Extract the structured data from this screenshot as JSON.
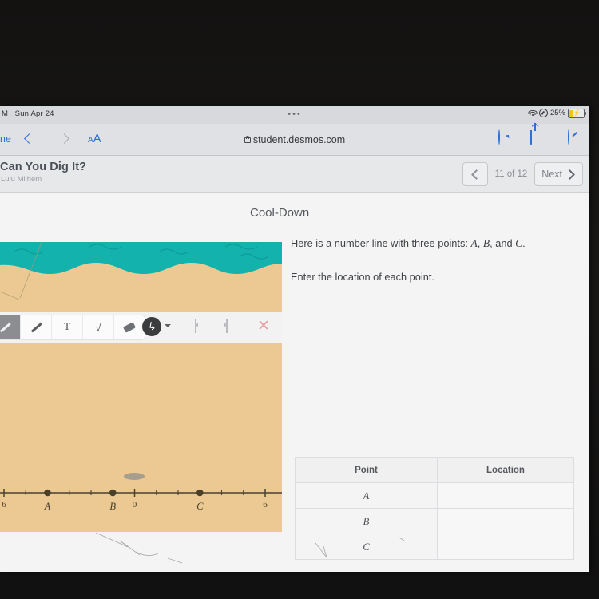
{
  "status_bar": {
    "time_cut": "M",
    "date": "Sun Apr 24",
    "dots": "•••",
    "battery_pct": "25%",
    "wifi_icon": "wifi-icon",
    "location_icon": "location-icon",
    "battery_icon": "battery-charging-icon"
  },
  "browser": {
    "done_label": "ne",
    "back_icon": "chevron-left-icon",
    "forward_icon": "chevron-right-icon",
    "text_size_label": "A",
    "text_size_small": "A",
    "url": "student.desmos.com",
    "lock_icon": "lock-icon",
    "reload_icon": "reload-icon",
    "share_icon": "share-icon",
    "tabs_icon": "compass-icon"
  },
  "activity": {
    "title": "Can You Dig It?",
    "author": "Lulu Milhem",
    "prev_icon": "chevron-left-icon",
    "pager": "11 of 12",
    "next_label": "Next",
    "next_icon": "chevron-right-icon"
  },
  "main": {
    "section_title": "Cool-Down",
    "prompt_prefix": "Here is a number line with three points: ",
    "point_a": "A",
    "comma1": ", ",
    "point_b": "B",
    "comma2": ", and ",
    "point_c": "C",
    "period": ".",
    "instruction": "Enter the location of each point."
  },
  "table": {
    "headers": [
      "Point",
      "Location"
    ],
    "rows": [
      {
        "point": "A",
        "location": ""
      },
      {
        "point": "B",
        "location": ""
      },
      {
        "point": "C",
        "location": ""
      }
    ]
  },
  "toolbar": {
    "tools": [
      {
        "name": "pen-tool",
        "icon": "pen-icon",
        "selected": true
      },
      {
        "name": "pencil-tool",
        "icon": "pencil-icon",
        "selected": false
      },
      {
        "name": "text-tool",
        "icon": "text-T-icon",
        "label": "T",
        "selected": false
      },
      {
        "name": "math-tool",
        "icon": "square-root-icon",
        "label": "√",
        "selected": false
      },
      {
        "name": "eraser-tool",
        "icon": "eraser-icon",
        "selected": false
      }
    ],
    "lasso_icon": "lasso-icon",
    "dropdown_icon": "chevron-down-icon",
    "undo_icon": "undo-icon",
    "redo_icon": "redo-icon",
    "close_icon": "close-x-icon"
  },
  "colors": {
    "water": "#13b2ac",
    "sand": "#ecc992",
    "accent_blue": "#2f6fd0",
    "battery_yellow": "#f0c419",
    "close_x": "#e8a0a0",
    "tool_selected": "#8b8d91"
  },
  "chart_data": {
    "type": "number-line",
    "title": "",
    "xlabel": "",
    "xlim": [
      -6,
      6
    ],
    "tick_step": 1,
    "labeled_ticks": [
      {
        "value": -6,
        "label": "6"
      },
      {
        "value": 0,
        "label": "0"
      },
      {
        "value": 6,
        "label": "6"
      }
    ],
    "points": [
      {
        "label": "A",
        "value": -4
      },
      {
        "label": "B",
        "value": -1
      },
      {
        "label": "C",
        "value": 3
      }
    ],
    "grid": false,
    "legend": "none"
  }
}
